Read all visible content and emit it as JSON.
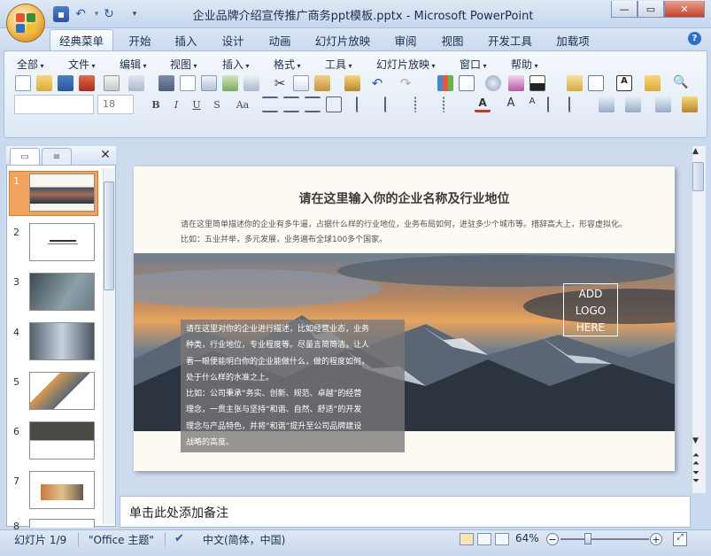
{
  "window": {
    "title": "企业品牌介绍宣传推广商务ppt模板.pptx - Microsoft PowerPoint"
  },
  "quick_access": {
    "undo_icon": "undo-icon",
    "redo_icon": "redo-icon",
    "save_icon": "save-icon"
  },
  "ribbon_tabs": [
    "经典菜单",
    "开始",
    "插入",
    "设计",
    "动画",
    "幻灯片放映",
    "审阅",
    "视图",
    "开发工具",
    "加载项"
  ],
  "menu_bar": [
    "全部",
    "文件",
    "编辑",
    "视图",
    "插入",
    "格式",
    "工具",
    "幻灯片放映",
    "窗口",
    "帮助"
  ],
  "font": {
    "name": "",
    "size": "18"
  },
  "format_buttons": [
    "B",
    "I",
    "U",
    "S",
    "Aa"
  ],
  "slides": {
    "numbers": [
      "1",
      "2",
      "3",
      "4",
      "5",
      "6",
      "7",
      "8"
    ],
    "selected": "1"
  },
  "slide": {
    "title": "请在这里输入你的企业名称及行业地位",
    "desc": "请在这里简单描述你的企业有多牛逼，占据什么样的行业地位，业务布局如何，进驻多少个城市等。措辞高大上，形容虚拟化。比如：五业并举，多元发展，业务遍布全球100多个国家。",
    "logo": [
      "ADD",
      "LOGO",
      "HERE"
    ],
    "overlay_lines": [
      "请在这里对你的企业进行描述，比如经营业态，业务",
      "种类，行业地位，专业程度等。尽量言简简洁，让人",
      "看一眼便能明白你的企业能做什么，做的程度如何，",
      "处于什么样的水准之上。",
      "比如：公司秉承“务实、创新、规范、卓越”的经营",
      "理念，一贯主张与坚持“和谐、自然、舒适”的开发",
      "理念与产品特色，并将“和谐”提升至公司品牌建设",
      "战略的高度。"
    ]
  },
  "notes": {
    "placeholder": "单击此处添加备注"
  },
  "status": {
    "slide": "幻灯片 1/9",
    "theme": "\"Office 主题\"",
    "language": "中文(简体，中国)",
    "zoom": "64%"
  },
  "colors": {
    "accent": "#f0a35c",
    "ribbon": "#dde8f5"
  }
}
